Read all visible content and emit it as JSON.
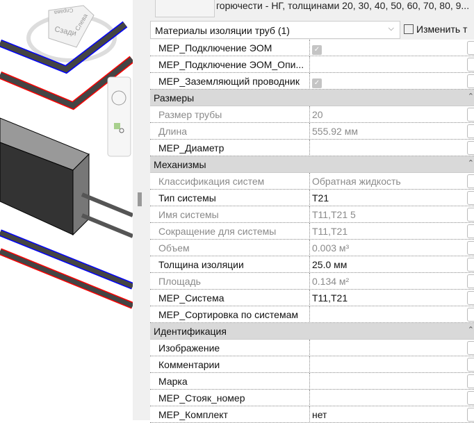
{
  "header": {
    "description": "горючести - НГ, толщинами 20, 30, 40, 50, 60, 70, 80, 9...",
    "type_selector": "Материалы изоляции труб (1)",
    "edit_type": "Изменить т"
  },
  "viewcube": {
    "faces": [
      "Сзади",
      "Слева",
      "Справа"
    ]
  },
  "rows": [
    {
      "type": "row",
      "name": "MEP_Подключение ЭОМ",
      "value": "",
      "checkbox": true
    },
    {
      "type": "row",
      "name": "MEP_Подключение ЭОМ_Опи...",
      "value": ""
    },
    {
      "type": "row",
      "name": "MEP_Заземляющий проводник",
      "value": "",
      "checkbox": true
    },
    {
      "type": "group",
      "name": "Размеры"
    },
    {
      "type": "row",
      "name": "Размер трубы",
      "value": "20",
      "readonly": true
    },
    {
      "type": "row",
      "name": "Длина",
      "value": "555.92 мм",
      "readonly": true
    },
    {
      "type": "row",
      "name": "MEP_Диаметр",
      "value": ""
    },
    {
      "type": "group",
      "name": "Механизмы"
    },
    {
      "type": "row",
      "name": "Классификация систем",
      "value": "Обратная жидкость",
      "readonly": true
    },
    {
      "type": "row",
      "name": "Тип системы",
      "value": "T21"
    },
    {
      "type": "row",
      "name": "Имя системы",
      "value": "T11,T21 5",
      "readonly": true
    },
    {
      "type": "row",
      "name": "Сокращение для системы",
      "value": "T11,T21",
      "readonly": true
    },
    {
      "type": "row",
      "name": "Объем",
      "value": "0.003 м³",
      "readonly": true
    },
    {
      "type": "row",
      "name": "Толщина изоляции",
      "value": "25.0 мм"
    },
    {
      "type": "row",
      "name": "Площадь",
      "value": "0.134 м²",
      "readonly": true
    },
    {
      "type": "row",
      "name": "MEP_Система",
      "value": "T11,T21"
    },
    {
      "type": "row",
      "name": "MEP_Сортировка по системам",
      "value": ""
    },
    {
      "type": "group",
      "name": "Идентификация"
    },
    {
      "type": "row",
      "name": "Изображение",
      "value": ""
    },
    {
      "type": "row",
      "name": "Комментарии",
      "value": ""
    },
    {
      "type": "row",
      "name": "Марка",
      "value": ""
    },
    {
      "type": "row",
      "name": "MEP_Стояк_номер",
      "value": ""
    },
    {
      "type": "row",
      "name": "MEP_Комплект",
      "value": "нет"
    }
  ],
  "colors": {
    "supply_pipe": "#ff0000",
    "return_pipe": "#0000ff",
    "group_bg": "#d9d9d9"
  }
}
